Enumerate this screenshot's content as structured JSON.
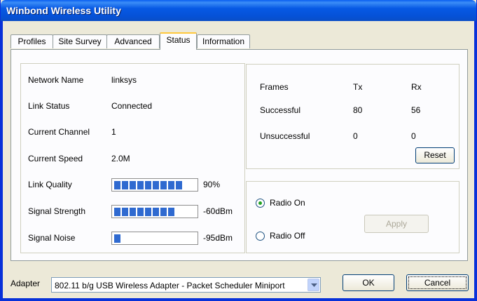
{
  "window": {
    "title": "Winbond Wireless Utility"
  },
  "tabs": [
    {
      "label": "Profiles"
    },
    {
      "label": "Site Survey"
    },
    {
      "label": "Advanced"
    },
    {
      "label": "Status"
    },
    {
      "label": "Information"
    }
  ],
  "active_tab": "Status",
  "status": {
    "network_name_label": "Network Name",
    "network_name": "linksys",
    "link_status_label": "Link Status",
    "link_status": "Connected",
    "channel_label": "Current Channel",
    "channel": "1",
    "speed_label": "Current Speed",
    "speed": "2.0M",
    "link_quality_label": "Link Quality",
    "link_quality": "90%",
    "link_quality_level": 0.9,
    "signal_strength_label": "Signal Strength",
    "signal_strength": "-60dBm",
    "signal_strength_level": 0.8,
    "signal_noise_label": "Signal Noise",
    "signal_noise": "-95dBm",
    "signal_noise_level": 0.1
  },
  "frames": {
    "header": "Frames",
    "tx_header": "Tx",
    "rx_header": "Rx",
    "successful_label": "Successful",
    "successful_tx": "80",
    "successful_rx": "56",
    "unsuccessful_label": "Unsuccessful",
    "unsuccessful_tx": "0",
    "unsuccessful_rx": "0",
    "reset_label": "Reset"
  },
  "radio": {
    "on_label": "Radio On",
    "off_label": "Radio Off",
    "selected": "on",
    "apply_label": "Apply"
  },
  "footer": {
    "adapter_label": "Adapter",
    "adapter_value": "802.11 b/g USB Wireless Adapter - Packet Scheduler Miniport",
    "ok_label": "OK",
    "cancel_label": "Cancel"
  },
  "colors": {
    "titlebar": "#0a5ff0",
    "bar_fill": "#2f6ad0",
    "radio_dot": "#21a121",
    "tab_highlight": "#ffc83c"
  }
}
